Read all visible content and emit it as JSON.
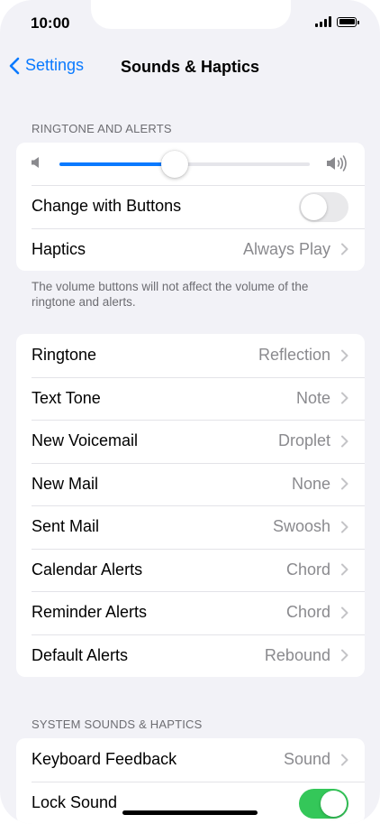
{
  "status": {
    "time": "10:00"
  },
  "nav": {
    "back_label": "Settings",
    "title": "Sounds & Haptics"
  },
  "ringtone_section": {
    "header": "RINGTONE AND ALERTS",
    "volume_level": 0.46,
    "change_with_buttons": {
      "label": "Change with Buttons",
      "on": false
    },
    "haptics": {
      "label": "Haptics",
      "value": "Always Play"
    },
    "footer": "The volume buttons will not affect the volume of the ringtone and alerts."
  },
  "tones": [
    {
      "label": "Ringtone",
      "value": "Reflection"
    },
    {
      "label": "Text Tone",
      "value": "Note"
    },
    {
      "label": "New Voicemail",
      "value": "Droplet"
    },
    {
      "label": "New Mail",
      "value": "None"
    },
    {
      "label": "Sent Mail",
      "value": "Swoosh"
    },
    {
      "label": "Calendar Alerts",
      "value": "Chord"
    },
    {
      "label": "Reminder Alerts",
      "value": "Chord"
    },
    {
      "label": "Default Alerts",
      "value": "Rebound"
    }
  ],
  "system_section": {
    "header": "SYSTEM SOUNDS & HAPTICS",
    "keyboard_feedback": {
      "label": "Keyboard Feedback",
      "value": "Sound"
    },
    "lock_sound": {
      "label": "Lock Sound",
      "on": true
    }
  },
  "colors": {
    "accent": "#0a7aff",
    "toggle_on": "#34c759",
    "background": "#f2f2f7"
  },
  "icons": {
    "back": "chevron-left-icon",
    "disclosure": "chevron-right-icon",
    "volume_low": "speaker-icon",
    "volume_high": "speaker-wave-icon"
  }
}
